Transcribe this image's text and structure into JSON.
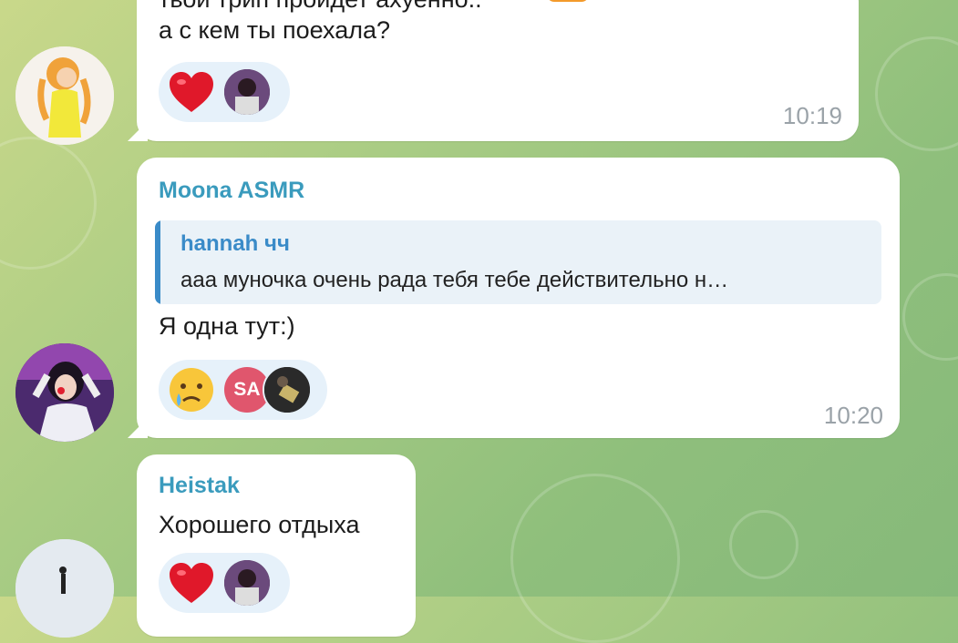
{
  "messages": [
    {
      "text_top": "твой трип пройдет ахуенно..",
      "text": "а с кем ты поехала?",
      "time": "10:19",
      "reactions": [
        "heart-emoji",
        "user-avatar"
      ]
    },
    {
      "sender": "Moona ASMR",
      "reply": {
        "name": "hannah чч",
        "text": "ааа муночка очень рада тебя  тебе действительно н…"
      },
      "text": "Я одна тут:)",
      "time": "10:20",
      "reactions": [
        "crying-emoji",
        "user-initials",
        "user-avatar"
      ],
      "reaction_initials": "SA"
    },
    {
      "sender": "Heistak",
      "text": "Хорошего отдыха",
      "reactions": [
        "heart-emoji",
        "user-avatar"
      ]
    }
  ],
  "colors": {
    "sender": "#3a9bbd",
    "reply_bar": "#3a8bc8",
    "reaction_bg": "#e6f1fa",
    "time": "#9aa2a8",
    "initials_badge": "#e0566d"
  }
}
